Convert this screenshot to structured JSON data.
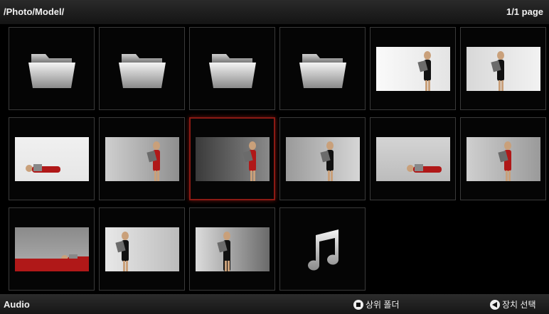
{
  "header": {
    "path": "/Photo/Model/",
    "page_info": "1/1 page"
  },
  "grid": {
    "items": [
      {
        "type": "folder"
      },
      {
        "type": "folder"
      },
      {
        "type": "folder"
      },
      {
        "type": "folder"
      },
      {
        "type": "photo",
        "scene": "lean-wall"
      },
      {
        "type": "photo",
        "scene": "stand-center"
      },
      {
        "type": "photo",
        "scene": "lying-left"
      },
      {
        "type": "photo",
        "scene": "hug-right"
      },
      {
        "type": "photo",
        "scene": "hug-center",
        "selected": true
      },
      {
        "type": "photo",
        "scene": "stand-right"
      },
      {
        "type": "photo",
        "scene": "lying-center"
      },
      {
        "type": "photo",
        "scene": "hug-right2"
      },
      {
        "type": "photo",
        "scene": "sofa"
      },
      {
        "type": "photo",
        "scene": "show-left"
      },
      {
        "type": "photo",
        "scene": "back-bw"
      },
      {
        "type": "music"
      }
    ]
  },
  "footer": {
    "mode": "Audio",
    "up_folder_label": "상위 폴더",
    "device_select_label": "장치 선택",
    "up_folder_icon": "stop-button-icon",
    "device_select_icon": "back-button-icon"
  },
  "colors": {
    "selection": "#8b1a14",
    "background": "#000000"
  }
}
